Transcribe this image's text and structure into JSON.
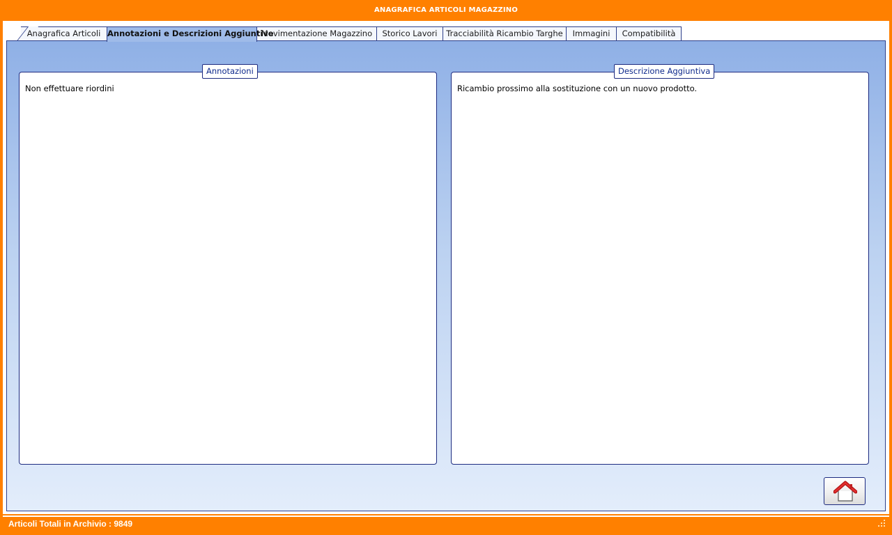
{
  "window": {
    "title": "ANAGRAFICA ARTICOLI MAGAZZINO"
  },
  "tabs": [
    {
      "label": "Anagrafica Articoli"
    },
    {
      "label": "Annotazioni  e Descrizioni Aggiuntive"
    },
    {
      "label": "Movimentazione Magazzino"
    },
    {
      "label": "Storico Lavori"
    },
    {
      "label": "Tracciabilità Ricambio Targhe"
    },
    {
      "label": "Immagini"
    },
    {
      "label": "Compatibilità"
    }
  ],
  "active_tab": "Annotazioni  e Descrizioni Aggiuntive",
  "annotations": {
    "title": "Annotazioni",
    "text": "Non effettuare riordini"
  },
  "additional_description": {
    "title": "Descrizione Aggiuntiva",
    "text": "Ricambio prossimo alla sostituzione con un nuovo prodotto."
  },
  "home_button": {
    "icon": "home-icon",
    "icon_color": "#d62020"
  },
  "status": {
    "text": "Articoli Totali in Archivio : 9849"
  },
  "colors": {
    "accent": "#ff8000",
    "tab_active": "#9fbbe9",
    "border": "#1c2a80",
    "title_text": "#0f2a8c"
  }
}
